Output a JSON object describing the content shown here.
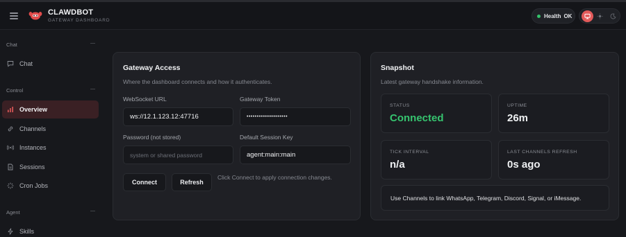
{
  "header": {
    "brand_title": "CLAWDBOT",
    "brand_subtitle": "GATEWAY DASHBOARD",
    "health_label": "Health",
    "health_value": "OK",
    "theme_modes": [
      "system",
      "light",
      "dark"
    ],
    "accent_color": "#e25a5a",
    "status_color": "#34c26a"
  },
  "sidebar": {
    "sections": [
      {
        "label": "Chat",
        "items": [
          {
            "label": "Chat",
            "icon": "chat-bubble-icon"
          }
        ]
      },
      {
        "label": "Control",
        "items": [
          {
            "label": "Overview",
            "icon": "bar-chart-icon",
            "active": true
          },
          {
            "label": "Channels",
            "icon": "link-icon"
          },
          {
            "label": "Instances",
            "icon": "radio-icon"
          },
          {
            "label": "Sessions",
            "icon": "document-icon"
          },
          {
            "label": "Cron Jobs",
            "icon": "loader-icon"
          }
        ]
      },
      {
        "label": "Agent",
        "items": [
          {
            "label": "Skills",
            "icon": "zap-icon"
          }
        ]
      }
    ]
  },
  "gateway_access": {
    "title": "Gateway Access",
    "subtitle": "Where the dashboard connects and how it authenticates.",
    "websocket_label": "WebSocket URL",
    "websocket_value": "ws://12.1.123.12:47716",
    "token_label": "Gateway Token",
    "token_value": "••••••••••••••••••••",
    "password_label": "Password (not stored)",
    "password_placeholder": "system or shared password",
    "session_key_label": "Default Session Key",
    "session_key_value": "agent:main:main",
    "connect_label": "Connect",
    "refresh_label": "Refresh",
    "hint": "Click Connect to apply connection changes."
  },
  "snapshot": {
    "title": "Snapshot",
    "subtitle": "Latest gateway handshake information.",
    "stats": [
      {
        "label": "STATUS",
        "value": "Connected"
      },
      {
        "label": "UPTIME",
        "value": "26m"
      },
      {
        "label": "TICK INTERVAL",
        "value": "n/a"
      },
      {
        "label": "LAST CHANNELS REFRESH",
        "value": "0s ago"
      }
    ],
    "note": "Use Channels to link WhatsApp, Telegram, Discord, Signal, or iMessage."
  }
}
